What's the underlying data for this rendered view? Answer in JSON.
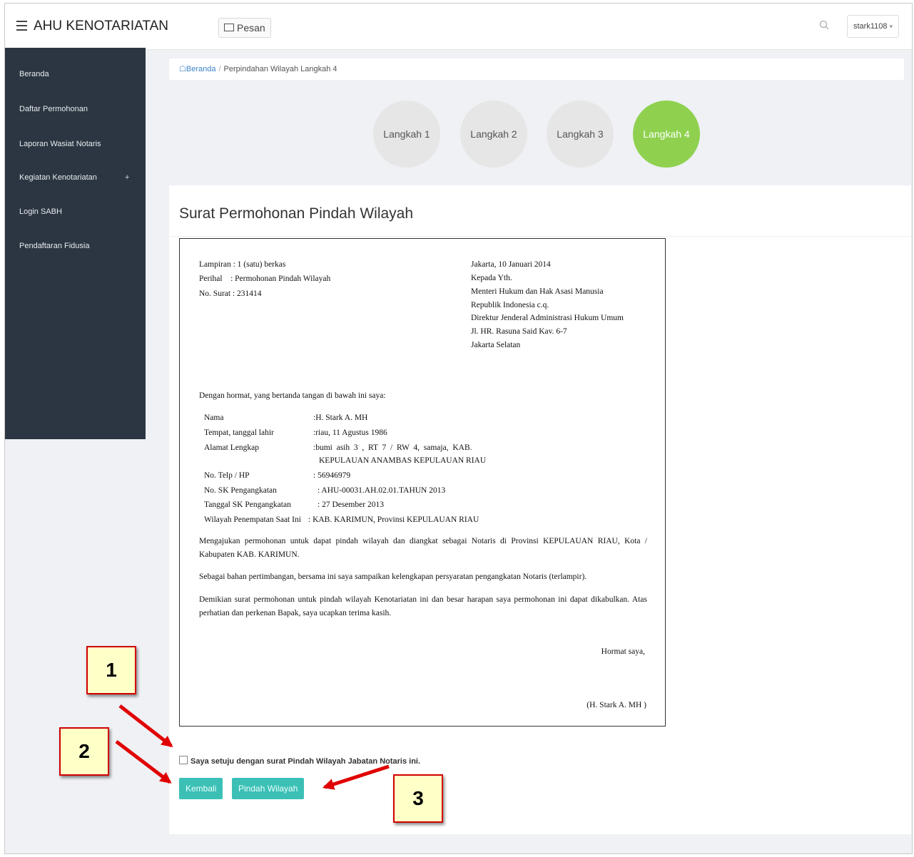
{
  "app": {
    "title": "AHU KENOTARIATAN"
  },
  "topbar": {
    "pesan_label": "Pesan",
    "user_label": "stark1108",
    "user_caret": "▾"
  },
  "sidebar": {
    "items": [
      {
        "label": "Beranda"
      },
      {
        "label": "Daftar Permohonan"
      },
      {
        "label": "Laporan Wasiat Notaris"
      },
      {
        "label": "Kegiatan Kenotariatan",
        "suffix": "+"
      },
      {
        "label": "Login SABH"
      },
      {
        "label": "Pendaftaran Fidusia"
      }
    ]
  },
  "breadcrumb": {
    "home": "Beranda",
    "separator": "/",
    "current": "Perpindahan Wilayah Langkah 4"
  },
  "steps": [
    {
      "label": "Langkah 1"
    },
    {
      "label": "Langkah 2"
    },
    {
      "label": "Langkah 3"
    },
    {
      "label": "Langkah 4",
      "active": true
    }
  ],
  "panel": {
    "title": "Surat Permohonan Pindah Wilayah"
  },
  "letter": {
    "lampiran": "Lampiran : 1 (satu) berkas",
    "perihal": "Perihal    : Permohonan Pindah Wilayah",
    "no_surat": "No. Surat : 231414",
    "address": [
      "Jakarta, 10 Januari 2014",
      "Kepada Yth.",
      "Menteri Hukum dan Hak Asasi Manusia",
      "Republik Indonesia c.q.",
      "Direktur Jenderal Administrasi Hukum Umum",
      "Jl. HR. Rasuna Said Kav. 6-7",
      "Jakarta Selatan"
    ],
    "greeting": "Dengan hormat, yang bertanda tangan di bawah ini saya:",
    "fields": [
      {
        "label": "Nama",
        "value": ":H. Stark A. MH"
      },
      {
        "label": "Tempat, tanggal lahir",
        "value": ":riau, 11 Agustus 1986"
      },
      {
        "label": "Alamat Lengkap",
        "value": ":bumi  asih  3  ,  RT  7  /  RW  4,  samaja,  KAB.",
        "value2": "KEPULAUAN ANAMBAS KEPULAUAN RIAU"
      },
      {
        "label": "No. Telp / HP",
        "value": ": 56946979"
      },
      {
        "label": "No. SK Pengangkatan",
        "value": ": AHU-00031.AH.02.01.TAHUN 2013"
      },
      {
        "label": "Tanggal SK Pengangkatan",
        "value": ": 27 Desember 2013"
      },
      {
        "label": "Wilayah Penempatan Saat Ini",
        "value": ": KAB. KARIMUN, Provinsi KEPULAUAN RIAU"
      }
    ],
    "para1": "Mengajukan permohonan untuk dapat pindah wilayah dan diangkat sebagai Notaris di Provinsi KEPULAUAN RIAU, Kota / Kabupaten KAB. KARIMUN.",
    "para2": "Sebagai bahan pertimbangan, bersama ini saya sampaikan kelengkapan persyaratan pengangkatan Notaris (terlampir).",
    "para3": "Demikian surat permohonan untuk pindah wilayah Kenotariatan ini dan besar harapan saya permohonan ini dapat dikabulkan. Atas perhatian dan perkenan Bapak, saya ucapkan terima kasih.",
    "closing": "Hormat saya,",
    "signature": "(H. Stark A. MH )"
  },
  "agreement": {
    "label": "Saya setuju dengan surat Pindah Wilayah Jabatan Notaris ini."
  },
  "buttons": {
    "back": "Kembali",
    "submit": "Pindah Wilayah"
  },
  "callouts": [
    "1",
    "2",
    "3"
  ],
  "colors": {
    "sidebar": "#2c3642",
    "active_step": "#8fd14f",
    "button": "#3cc0b6",
    "callout_border": "#d10000",
    "callout_fill": "#ffffc8",
    "arrow": "#e00000"
  }
}
